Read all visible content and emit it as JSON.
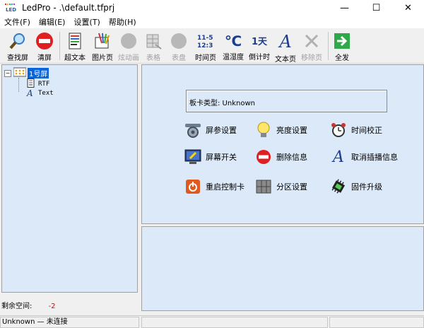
{
  "window": {
    "title": "LedPro - .\\default.tfprj",
    "logo_text": "LED",
    "minimize": "—",
    "maximize": "☐",
    "close": "✕"
  },
  "menu": [
    "文件(F)",
    "编辑(E)",
    "设置(T)",
    "帮助(H)"
  ],
  "toolbar": {
    "items": [
      {
        "label": "查找屏",
        "icon": "magnifier-icon",
        "enabled": true
      },
      {
        "label": "清屏",
        "icon": "no-entry-icon",
        "enabled": true
      },
      {
        "label": "超文本",
        "icon": "document-icon",
        "enabled": true
      },
      {
        "label": "图片页",
        "icon": "picture-icon",
        "enabled": true
      },
      {
        "label": "炫动画",
        "icon": "gray-circle-icon",
        "enabled": false
      },
      {
        "label": "表格",
        "icon": "table-icon",
        "enabled": false
      },
      {
        "label": "表盘",
        "icon": "gray-circle-icon",
        "enabled": false
      },
      {
        "label": "时间页",
        "icon": "clock-digits-icon",
        "enabled": true,
        "icon_text": "11-5 12:3"
      },
      {
        "label": "温湿度",
        "icon": "celsius-icon",
        "enabled": true,
        "icon_text": "℃"
      },
      {
        "label": "倒计时",
        "icon": "countdown-icon",
        "enabled": true,
        "icon_text": "1天"
      },
      {
        "label": "文本页",
        "icon": "text-a-icon",
        "enabled": true,
        "icon_text": "A"
      },
      {
        "label": "移除页",
        "icon": "remove-x-icon",
        "enabled": false
      },
      {
        "label": "全发",
        "icon": "send-arrow-icon",
        "enabled": true
      }
    ]
  },
  "tree": {
    "root": "1号屏",
    "children": [
      "RTF",
      "Text"
    ]
  },
  "free_space": {
    "label": "剩余空间:",
    "value": "-2"
  },
  "card_type": {
    "label": "板卡类型:  Unknown"
  },
  "actions": [
    {
      "label": "屏参设置",
      "icon": "gear-settings-icon"
    },
    {
      "label": "亮度设置",
      "icon": "light-bulb-icon"
    },
    {
      "label": "时间校正",
      "icon": "alarm-clock-icon"
    },
    {
      "label": "屏幕开关",
      "icon": "monitor-power-icon"
    },
    {
      "label": "删除信息",
      "icon": "delete-icon"
    },
    {
      "label": "取消插播信息",
      "icon": "text-a-icon"
    },
    {
      "label": "重启控制卡",
      "icon": "restart-icon"
    },
    {
      "label": "分区设置",
      "icon": "partition-icon"
    },
    {
      "label": "固件升级",
      "icon": "chip-icon"
    }
  ],
  "status": {
    "connection": "Unknown — 未连接"
  },
  "colors": {
    "panel_bg": "#dce9f8",
    "selected": "#0a64d8",
    "free_space_value": "#e00000"
  }
}
